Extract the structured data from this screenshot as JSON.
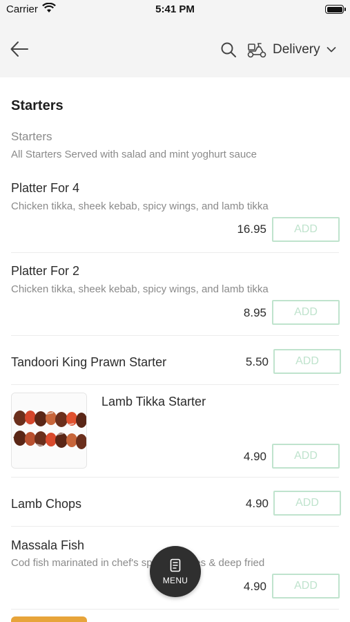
{
  "status_bar": {
    "carrier": "Carrier",
    "time": "5:41 PM"
  },
  "header": {
    "delivery_label": "Delivery"
  },
  "section": {
    "title": "Starters",
    "category_name": "Starters",
    "category_desc": "All Starters Served with salad and mint yoghurt sauce"
  },
  "items": [
    {
      "name": "Platter For 4",
      "desc": "Chicken tikka, sheek kebab, spicy wings, and lamb tikka",
      "price": "16.95",
      "add": "ADD"
    },
    {
      "name": "Platter For 2",
      "desc": "Chicken tikka, sheek kebab, spicy wings, and lamb tikka",
      "price": "8.95",
      "add": "ADD"
    },
    {
      "name": "Tandoori King Prawn Starter",
      "price": "5.50",
      "add": "ADD"
    },
    {
      "name": "Lamb Tikka Starter",
      "price": "4.90",
      "add": "ADD"
    },
    {
      "name": "Lamb Chops",
      "price": "4.90",
      "add": "ADD"
    },
    {
      "name": "Massala Fish",
      "desc": "Cod fish marinated in chef's special spices & deep fried",
      "price": "4.90",
      "add": "ADD"
    }
  ],
  "menu_fab": {
    "label": "MENU"
  },
  "icons": {
    "back": "arrow-left-icon",
    "search": "search-icon",
    "delivery": "scooter-icon",
    "dropdown": "chevron-down-icon",
    "menu": "menu-card-icon"
  },
  "colors": {
    "add_border": "#bfe3cd",
    "header_bg": "#f4f4f4",
    "fab_bg": "#2f2f2f"
  }
}
